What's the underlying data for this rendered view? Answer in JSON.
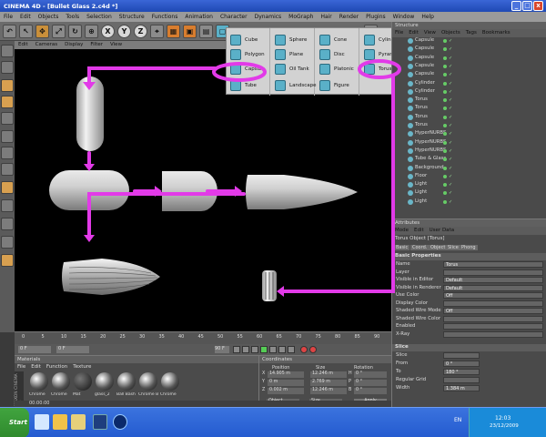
{
  "window": {
    "title": "CINEMA 4D - [Bullet Glass 2.c4d *]",
    "min": "_",
    "max": "□",
    "close": "x"
  },
  "menubar": [
    "File",
    "Edit",
    "Objects",
    "Tools",
    "Selection",
    "Structure",
    "Functions",
    "Animation",
    "Character",
    "Dynamics",
    "MoGraph",
    "Hair",
    "Render",
    "Plugins",
    "Window",
    "Help"
  ],
  "toolbar": {
    "x": "X",
    "y": "Y",
    "z": "Z"
  },
  "viewport_menu": [
    "Edit",
    "Cameras",
    "Display",
    "Filter",
    "View"
  ],
  "primitives_menu": {
    "col1": [
      "Cube",
      "Polygon",
      "Capsule",
      "Tube"
    ],
    "col2": [
      "Sphere",
      "Plane",
      "Oil Tank",
      "Landscape"
    ],
    "col3": [
      "Cone",
      "Disc",
      "Platonic",
      "Figure"
    ],
    "col4": [
      "Cylinder",
      "Pyramid",
      "Torus"
    ]
  },
  "object_manager": {
    "tab": "Structure",
    "menu": [
      "File",
      "Edit",
      "View",
      "Objects",
      "Tags",
      "Bookmarks"
    ],
    "rows": [
      "Capsule",
      "Capsule",
      "Capsule",
      "Capsule",
      "Capsule",
      "Cylinder",
      "Cylinder",
      "Torus",
      "Torus",
      "Torus",
      "Torus",
      "HyperNURBS",
      "HyperNURBS",
      "HyperNURBS",
      "Tube & Glass",
      "Background",
      "Floor",
      "Light",
      "Light",
      "Light"
    ]
  },
  "attributes": {
    "tab": "Attributes",
    "menu": [
      "Mode",
      "Edit",
      "User Data"
    ],
    "object_title": "Torus Object [Torus]",
    "tabs": [
      "Basic",
      "Coord.",
      "Object",
      "Slice",
      "Phong"
    ],
    "section": "Basic Properties",
    "fields": [
      {
        "label": "Name",
        "value": "Torus"
      },
      {
        "label": "Layer",
        "value": ""
      },
      {
        "label": "Visible in Editor",
        "value": "Default"
      },
      {
        "label": "Visible in Renderer",
        "value": "Default"
      },
      {
        "label": "Use Color",
        "value": "Off"
      },
      {
        "label": "Display Color",
        "value": ""
      },
      {
        "label": "Shaded Wire Mode",
        "value": "Off"
      },
      {
        "label": "Shaded Wire Color",
        "value": ""
      },
      {
        "label": "Enabled",
        "value": ""
      },
      {
        "label": "X-Ray",
        "value": ""
      }
    ],
    "slice_section": "Slice",
    "slice_fields": [
      {
        "label": "Slice",
        "value": ""
      },
      {
        "label": "From",
        "value": "0 °"
      },
      {
        "label": "To",
        "value": "180 °"
      },
      {
        "label": "Regular Grid",
        "value": ""
      },
      {
        "label": "Width",
        "value": "1.384 m"
      }
    ]
  },
  "timeline": {
    "ticks": [
      "0",
      "5",
      "10",
      "15",
      "20",
      "25",
      "30",
      "35",
      "40",
      "45",
      "50",
      "55",
      "60",
      "65",
      "70",
      "75",
      "80",
      "85",
      "90"
    ],
    "start": "0 F",
    "end": "90 F",
    "current": "0 F"
  },
  "materials": {
    "tab": "Materials",
    "menu": [
      "File",
      "Edit",
      "Function",
      "Texture"
    ],
    "items": [
      "Chrome",
      "Chrome",
      "Mat",
      "glass_2",
      "Ball Bash",
      "Chrome Bl",
      "Chrome"
    ],
    "brand": "MAXON CINEMA 4D"
  },
  "coordinates": {
    "tab": "Coordinates",
    "headers": [
      "Position",
      "Size",
      "Rotation"
    ],
    "rows": [
      {
        "axis": "X",
        "pos": "14.905 m",
        "size": "12.246 m",
        "rot_label": "H",
        "rot": "0 °"
      },
      {
        "axis": "Y",
        "pos": "0 m",
        "size": "2.769 m",
        "rot_label": "P",
        "rot": "0 °"
      },
      {
        "axis": "Z",
        "pos": "0.002 m",
        "size": "12.246 m",
        "rot_label": "B",
        "rot": "0 °"
      }
    ],
    "mode1": "Object",
    "mode2": "Size",
    "apply": "Apply"
  },
  "status": "00:00:00",
  "taskbar": {
    "start": "Start",
    "lang": "EN",
    "time": "12:03",
    "date": "23/12/2009"
  }
}
